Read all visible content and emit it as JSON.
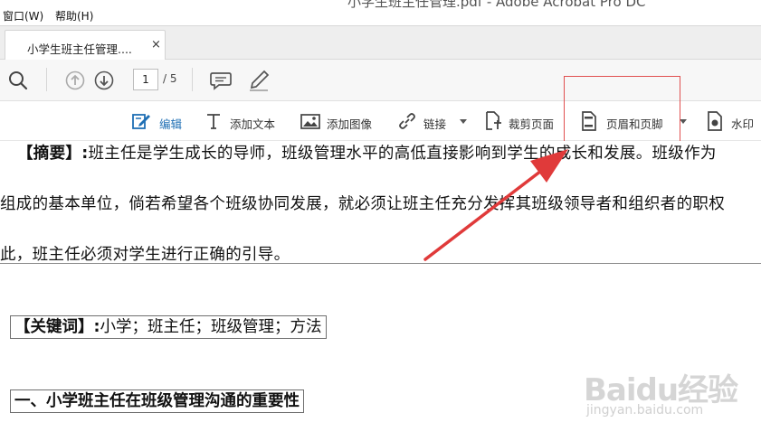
{
  "menubar": {
    "items": [
      "窗口(W)",
      "帮助(H)"
    ],
    "window_title": "小学生班主任管理.pdf - Adobe Acrobat Pro DC"
  },
  "tab": {
    "label": "小学生班主任管理....",
    "close": "×"
  },
  "toolbar": {
    "page_current": "1",
    "page_total": "/ 5",
    "icons": [
      "search-icon",
      "prev-page-icon",
      "next-page-icon",
      "comment-icon",
      "sign-icon"
    ]
  },
  "edit_toolbar": {
    "edit": "编辑",
    "add_text": "添加文本",
    "add_image": "添加图像",
    "link": "链接",
    "crop": "裁剪页面",
    "header_footer": "页眉和页脚",
    "watermark": "水印"
  },
  "document": {
    "abstract_label": "【摘要】:",
    "line1": "班主任是学生成长的导师，班级管理水平的高低直接影响到学生的成长和发展。班级作为",
    "line2": "组成的基本单位，倘若希望各个班级协同发展，就必须让班主任充分发挥其班级领导者和组织者的职权",
    "line3": "此，班主任必须对学生进行正确的引导。",
    "keywords_label": "【关键词】:",
    "keywords": "小学；班主任；班级管理；方法",
    "heading1": "一、小学班主任在班级管理沟通的重要性"
  },
  "watermark": {
    "logo": "Baidu经验",
    "url": "jingyan.baidu.com"
  },
  "colors": {
    "accent_blue": "#1f6fb4",
    "annotation_red": "#e03a3a",
    "highlight_border": "#e05050"
  }
}
